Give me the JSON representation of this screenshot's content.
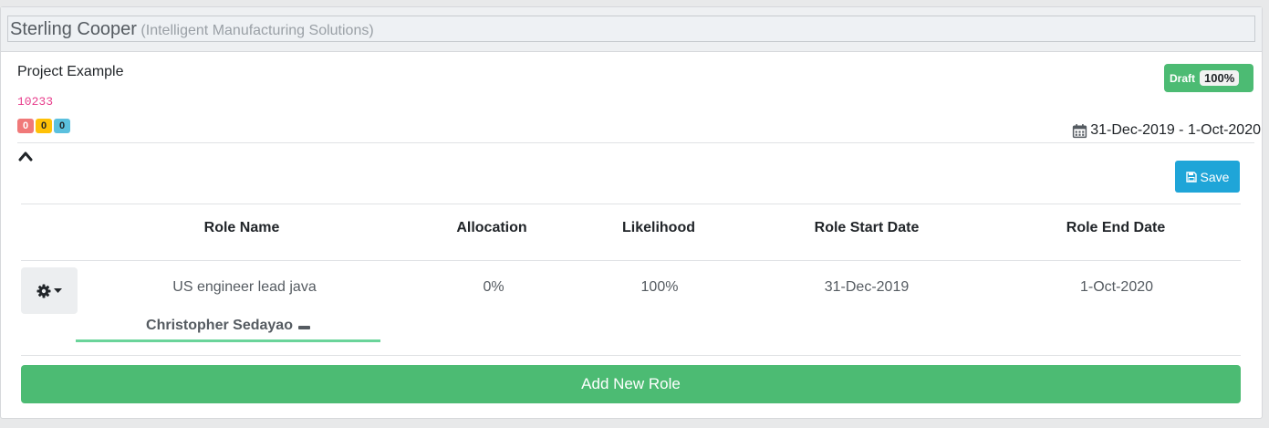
{
  "header": {
    "company": "Sterling Cooper",
    "subtitle": "(Intelligent Manufacturing Solutions)"
  },
  "project": {
    "title": "Project Example",
    "code": "10233",
    "badges": [
      "0",
      "0",
      "0"
    ],
    "status_label": "Draft",
    "status_percent": "100%",
    "date_range": "31-Dec-2019 - 1-Oct-2020"
  },
  "toolbar": {
    "save_label": "Save"
  },
  "table": {
    "headers": [
      "Role Name",
      "Allocation",
      "Likelihood",
      "Role Start Date",
      "Role End Date"
    ],
    "rows": [
      {
        "role_name": "US engineer lead java",
        "allocation": "0%",
        "likelihood": "100%",
        "start_date": "31-Dec-2019",
        "end_date": "1-Oct-2020",
        "assignee": "Christopher Sedayao"
      }
    ]
  },
  "actions": {
    "add_role_label": "Add New Role"
  },
  "colors": {
    "green": "#4cbb73",
    "save_blue": "#1fa5d8",
    "badge_red": "#f07979",
    "badge_yellow": "#ffc107",
    "badge_blue": "#5bc0de",
    "code_pink": "#e83e8c"
  },
  "icons": [
    "calendar-icon",
    "chevron-up-icon",
    "floppy-disk-icon",
    "gear-icon",
    "caret-down-icon",
    "minus-icon"
  ]
}
